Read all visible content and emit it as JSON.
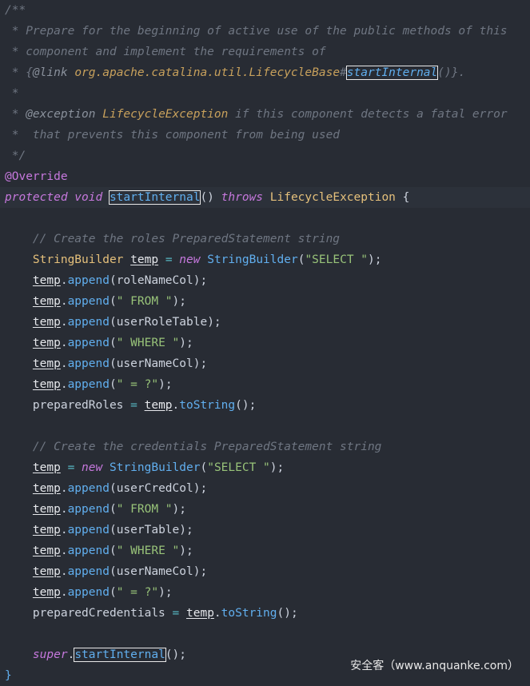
{
  "code": {
    "doc_lines": [
      "/**",
      " * Prepare for the beginning of active use of the public methods of this",
      " * component and implement the requirements of",
      " * {@link org.apache.catalina.util.LifecycleBase#startInternal()}.",
      " *",
      " * @exception LifecycleException if this component detects a fatal error",
      " *  that prevents this component from being used",
      " */"
    ],
    "annotation": "@Override",
    "method_signature": {
      "modifiers": "protected void ",
      "name": "startInternal",
      "params": "() ",
      "throws_kw": "throws ",
      "exception": "LifecycleException",
      "brace": " {"
    },
    "comment_roles": "// Create the roles PreparedStatement string",
    "comment_creds": "// Create the credentials PreparedStatement string",
    "roles_block": {
      "decl_type": "StringBuilder",
      "var": "temp",
      "new_kw": "new",
      "ctor": "StringBuilder",
      "select": "\"SELECT \"",
      "appends": [
        "roleNameCol",
        "\" FROM \"",
        "userRoleTable",
        "\" WHERE \"",
        "userNameCol",
        "\" = ?\""
      ],
      "assign_target": "preparedRoles",
      "tostring": "toString"
    },
    "creds_block": {
      "appends": [
        "userCredCol",
        "\" FROM \"",
        "userTable",
        "\" WHERE \"",
        "userNameCol",
        "\" = ?\""
      ],
      "assign_target": "preparedCredentials"
    },
    "super_kw": "super",
    "super_call": "startInternal",
    "closing": "}",
    "append_fn": "append"
  },
  "watermark": "安全客（www.anquanke.com）"
}
